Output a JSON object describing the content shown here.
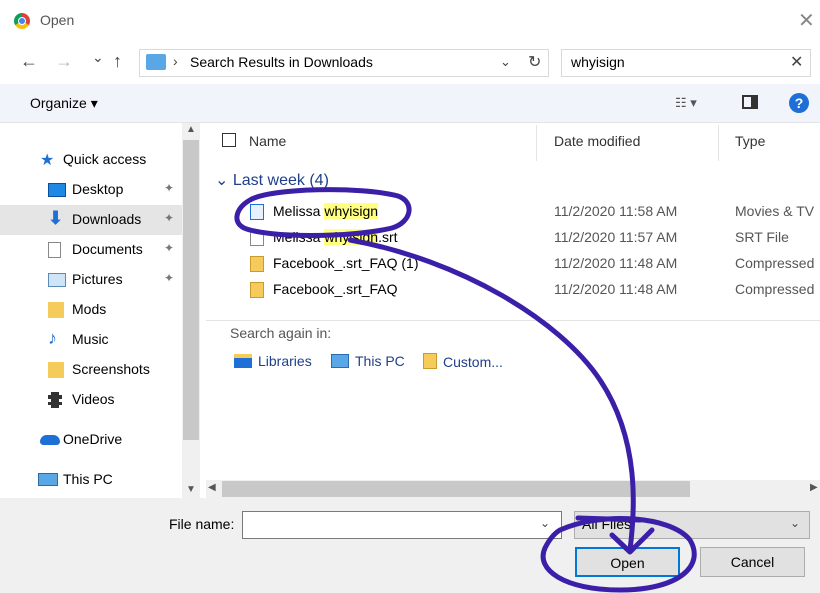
{
  "window": {
    "title": "Open",
    "close_symbol": "✕"
  },
  "nav": {
    "back": "←",
    "forward": "→",
    "recent": "⌄",
    "up": "↑",
    "breadcrumb_sep": "›",
    "address": "Search Results in Downloads",
    "address_dropdown": "⌄",
    "refresh": "↻",
    "search_value": "whyisign",
    "search_clear": "✕"
  },
  "toolbar": {
    "organize": "Organize ▾",
    "view_symbol": "☷ ▾",
    "help": "?"
  },
  "sidebar": {
    "items": [
      {
        "label": "Quick access",
        "icon": "star-icon",
        "pinned": false
      },
      {
        "label": "Desktop",
        "icon": "desktop-icon",
        "pinned": true
      },
      {
        "label": "Downloads",
        "icon": "download-icon",
        "pinned": true,
        "selected": true
      },
      {
        "label": "Documents",
        "icon": "documents-icon",
        "pinned": true
      },
      {
        "label": "Pictures",
        "icon": "pictures-icon",
        "pinned": true
      },
      {
        "label": "Mods",
        "icon": "folder-icon",
        "pinned": false
      },
      {
        "label": "Music",
        "icon": "music-icon",
        "pinned": false
      },
      {
        "label": "Screenshots",
        "icon": "folder-icon",
        "pinned": false
      },
      {
        "label": "Videos",
        "icon": "videos-icon",
        "pinned": false
      },
      {
        "label": "OneDrive",
        "icon": "onedrive-icon",
        "pinned": false
      },
      {
        "label": "This PC",
        "icon": "pc-icon",
        "pinned": false
      }
    ],
    "pin_symbol": "📌"
  },
  "columns": {
    "name": "Name",
    "date": "Date modified",
    "type": "Type"
  },
  "group": {
    "label": "Last week (4)"
  },
  "files": [
    {
      "name_prefix": "Melissa ",
      "name_hl": "whyisign",
      "name_suffix": "",
      "date": "11/2/2020 11:58 AM",
      "type": "Movies & TV",
      "icon": "video-file-icon"
    },
    {
      "name_prefix": "Melissa ",
      "name_hl": "whyisign",
      "name_suffix": ".srt",
      "date": "11/2/2020 11:57 AM",
      "type": "SRT File",
      "icon": "text-file-icon"
    },
    {
      "name_prefix": "Facebook_.srt_FAQ (1)",
      "name_hl": "",
      "name_suffix": "",
      "date": "11/2/2020 11:48 AM",
      "type": "Compressed",
      "icon": "zip-file-icon"
    },
    {
      "name_prefix": "Facebook_.srt_FAQ",
      "name_hl": "",
      "name_suffix": "",
      "date": "11/2/2020 11:48 AM",
      "type": "Compressed",
      "icon": "zip-file-icon"
    }
  ],
  "search_again": {
    "label": "Search again in:",
    "options": [
      "Libraries",
      "This PC",
      "Custom..."
    ]
  },
  "bottom": {
    "file_name_label": "File name:",
    "file_name_value": "",
    "filter": "All Files",
    "open": "Open",
    "cancel": "Cancel"
  },
  "colors": {
    "annotation": "#3b1fa8",
    "highlight": "#ffff80",
    "accent": "#0078d7"
  }
}
